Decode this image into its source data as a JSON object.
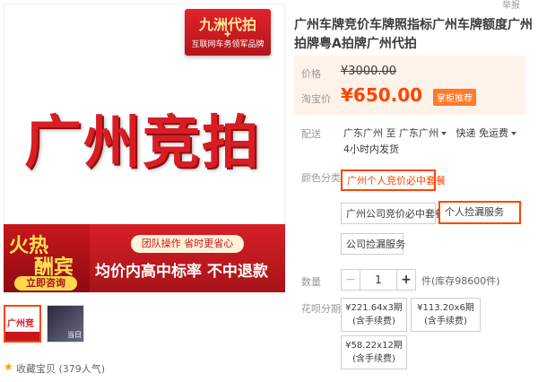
{
  "top_link": "举报",
  "main_image": {
    "badge_title": "九洲代拍",
    "badge_subtitle": "互联网车务领军品牌",
    "big_title": "广州竞拍",
    "hot_line1": "火热",
    "hot_line2": "酬宾",
    "consult_label": "立即咨询",
    "team_label": "团队操作 省时更省心",
    "slogan": "均价内高中标率 不中退款"
  },
  "thumbnails": [
    {
      "text": "广州竞拍"
    },
    {
      "text": "当日"
    }
  ],
  "favorite": {
    "label": "收藏宝贝",
    "popularity": "(379人气)"
  },
  "product": {
    "title": "广州车牌竞价车牌照指标广州车牌额度广州拍牌粤A拍牌广州代拍",
    "price_label": "价格",
    "original_price": "¥3000.00",
    "taobao_price_label": "淘宝价",
    "price": "¥650.00",
    "recommend_badge": "掌柜推荐"
  },
  "shipping": {
    "label": "配送",
    "from": "广东广州",
    "to_word": "至",
    "to": "广东广州",
    "method": "快递 免运费",
    "time": "4小时内发货"
  },
  "color_options": {
    "label": "颜色分类",
    "options": [
      {
        "label": "广州个人竞价必中套餐",
        "selected": true
      },
      {
        "label": "广州公司竞价必中套餐",
        "selected": false
      },
      {
        "label": "个人捡漏服务",
        "selected": false
      },
      {
        "label": "公司捡漏服务",
        "selected": false
      }
    ]
  },
  "quantity": {
    "label": "数量",
    "minus": "−",
    "value": "1",
    "plus": "+",
    "stock": "件(库存98600件)"
  },
  "installment": {
    "label": "花呗分期",
    "options": [
      {
        "line1": "¥221.64x3期",
        "line2": "(含手续费)"
      },
      {
        "line1": "¥113.20x6期",
        "line2": "(含手续费)"
      },
      {
        "line1": "¥58.22x12期",
        "line2": "(含手续费)"
      }
    ]
  },
  "colors": {
    "accent": "#ff4400",
    "brand_red": "#d81e24",
    "price_bg": "#fff2e8",
    "star": "#ff9d00"
  }
}
